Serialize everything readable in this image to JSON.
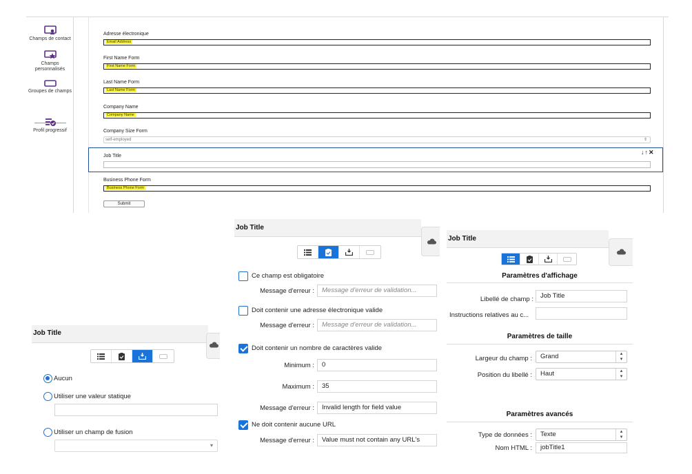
{
  "sidebar": {
    "items": [
      {
        "label": "Champs de contact",
        "icon": "contact-fields-icon"
      },
      {
        "label": "Champs personnalisés",
        "icon": "custom-fields-icon"
      },
      {
        "label": "Groupes de champs",
        "icon": "field-groups-icon"
      },
      {
        "label": "Profil progressif",
        "icon": "progressive-profile-icon"
      }
    ]
  },
  "form": {
    "fields": [
      {
        "label": "Adresse électronique",
        "value": "Email Address"
      },
      {
        "label": "First Name Form",
        "value": "First Name Form"
      },
      {
        "label": "Last Name Form",
        "value": "Last Name Form"
      },
      {
        "label": "Company Name",
        "value": "Company Name"
      },
      {
        "label": "Company Size Form",
        "value": "self-employed"
      },
      {
        "label": "Job Title",
        "value": ""
      },
      {
        "label": "Business Phone Form",
        "value": "Business Phone Form"
      }
    ],
    "row_actions": "↓↑✕",
    "submit_label": "Submit"
  },
  "panel_left": {
    "title": "Job Title",
    "radio_options": [
      "Aucun",
      "Utiliser une valeur statique",
      "Utiliser un champ de fusion"
    ],
    "selected_index": 0
  },
  "panel_middle": {
    "title": "Job Title",
    "rules": [
      {
        "label": "Ce champ est obligatoire",
        "checked": false
      },
      {
        "label": "Doit contenir une adresse électronique valide",
        "checked": false
      },
      {
        "label": "Doit contenir un nombre de caractères valide",
        "checked": true
      },
      {
        "label": "Ne doit contenir aucune URL",
        "checked": true
      }
    ],
    "error_label": "Message d'erreur :",
    "error_placeholder": "Message d'erreur de validation...",
    "min_label": "Minimum :",
    "min_value": "0",
    "max_label": "Maximum :",
    "max_value": "35",
    "length_error": "Invalid length for field value",
    "url_error": "Value must not contain any URL's"
  },
  "panel_right": {
    "title": "Job Title",
    "display_section": "Paramètres d'affichage",
    "field_label_label": "Libellé de champ :",
    "field_label_value": "Job Title",
    "instructions_label": "Instructions relatives au c...",
    "instructions_value": "",
    "size_section": "Paramètres de taille",
    "width_label": "Largeur du champ :",
    "width_value": "Grand",
    "position_label": "Position du libellé :",
    "position_value": "Haut",
    "advanced_section": "Paramètres avancés",
    "datatype_label": "Type de données :",
    "datatype_value": "Texte",
    "html_name_label": "Nom HTML :",
    "html_name_value": "jobTitle1"
  },
  "colors": {
    "accent": "#1a73d9",
    "sidebar_icon": "#5b2d86",
    "highlight": "#fff83a",
    "selected_border": "#1e4f9c"
  }
}
